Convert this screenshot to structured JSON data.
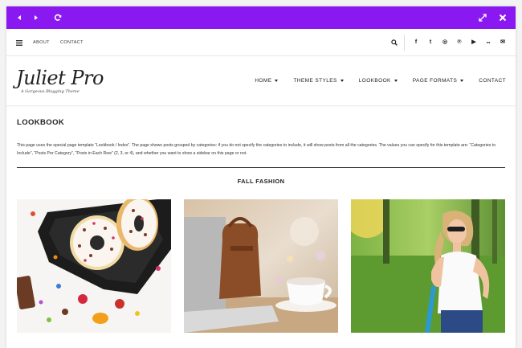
{
  "preview_bar": {
    "color": "#8a18f0",
    "left_icons": [
      "arrow-left-icon",
      "arrow-right-icon",
      "refresh-icon"
    ],
    "right_icons": [
      "expand-icon",
      "close-icon"
    ]
  },
  "topbar": {
    "menu_icon": "hamburger-icon",
    "links": [
      "ABOUT",
      "CONTACT"
    ],
    "search_icon": "search-icon",
    "social": [
      {
        "name": "facebook-icon",
        "glyph": "f"
      },
      {
        "name": "twitter-icon",
        "glyph": "t"
      },
      {
        "name": "instagram-icon",
        "glyph": "◎"
      },
      {
        "name": "pinterest-icon",
        "glyph": "℗"
      },
      {
        "name": "youtube-icon",
        "glyph": "▶"
      },
      {
        "name": "flickr-icon",
        "glyph": "●●"
      },
      {
        "name": "email-icon",
        "glyph": "✉"
      }
    ]
  },
  "header": {
    "logo": "Juliet Pro",
    "tagline": "A Gorgeous Blogging Theme",
    "nav": [
      {
        "label": "HOME",
        "dropdown": true
      },
      {
        "label": "THEME STYLES",
        "dropdown": true
      },
      {
        "label": "LOOKBOOK",
        "dropdown": true
      },
      {
        "label": "PAGE FORMATS",
        "dropdown": true
      },
      {
        "label": "CONTACT",
        "dropdown": false
      }
    ]
  },
  "page": {
    "title": "LOOKBOOK",
    "description": "This page uses the special page template “Lookbook / Index”. The page shows posts grouped by categories: if you do not specify the categories to include, it will show posts from all the categories. The values you can specify for this template are: “Categories to Include”, “Posts Per Category”, “Posts in Each Row” (2, 3, or 4), and whether you want to show a sidebar on this page or not.",
    "section": "FALL FASHION",
    "posts": [
      "donuts-photo",
      "laptop-coffee-photo",
      "woman-sunglasses-photo"
    ]
  }
}
